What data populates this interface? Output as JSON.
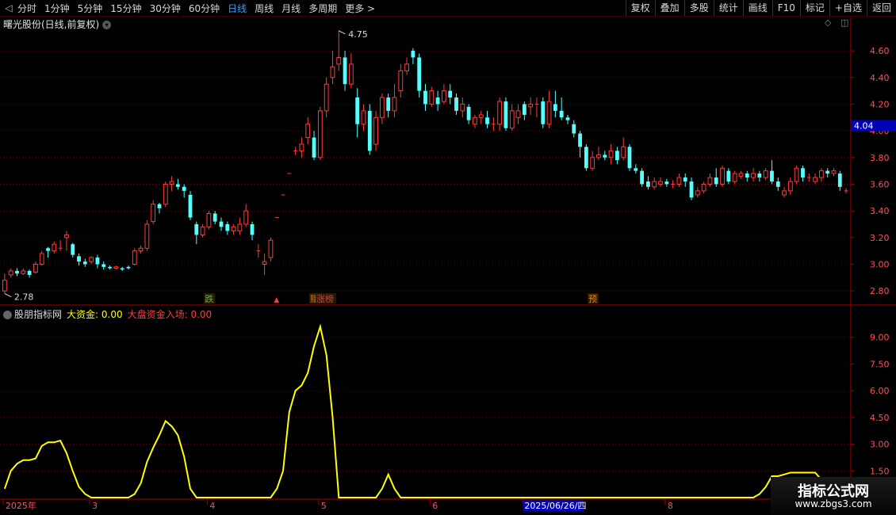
{
  "toolbar": {
    "tabs": [
      "分时",
      "1分钟",
      "5分钟",
      "15分钟",
      "30分钟",
      "60分钟",
      "日线",
      "周线",
      "月线",
      "多周期",
      "更多 >"
    ],
    "active_tab": "日线",
    "right_buttons": [
      "复权",
      "叠加",
      "多股",
      "统计",
      "画线",
      "F10",
      "标记",
      "+自选",
      "返回"
    ]
  },
  "stock": {
    "title": "曙光股份(日线,前复权)",
    "current_price_label": "4.04",
    "high_label": "4.75",
    "low_label": "2.78"
  },
  "indicator": {
    "name": "股朋指标网",
    "big_fund": "大资金: 0.00",
    "market_fund": "大盘资金入场: 0.00"
  },
  "signals": [
    {
      "day": 33,
      "text": "跌",
      "color": "#3cc43c"
    },
    {
      "day": 44,
      "text": "▲",
      "color": "#ff3b3b"
    },
    {
      "day": 50,
      "text": "赚",
      "color": "#c87a2a"
    },
    {
      "day": 51,
      "text": "涨榜",
      "color": "#d04040"
    },
    {
      "day": 95,
      "text": "预",
      "color": "#e08a2a"
    }
  ],
  "date_axis": {
    "labels": [
      {
        "day": 0,
        "text": "2025年"
      },
      {
        "day": 14,
        "text": "3"
      },
      {
        "day": 33,
        "text": "4"
      },
      {
        "day": 51,
        "text": "5"
      },
      {
        "day": 69,
        "text": "6"
      },
      {
        "day": 84,
        "text": "2025/06/26/四",
        "highlight": true
      },
      {
        "day": 107,
        "text": "8"
      }
    ]
  },
  "watermark": {
    "line1": "指标公式网",
    "line2": "www.zbgs3.com"
  },
  "colors": {
    "up": "#ff3b3b",
    "down": "#54ffff",
    "indicator_line": "#ffff00",
    "grid": "#5a0000",
    "axis_text": "#ff5050",
    "price_tag_bg": "#0000b4"
  },
  "chart_data": [
    {
      "type": "candlestick",
      "title": "曙光股份(日线,前复权)",
      "ylim": [
        2.7,
        4.85
      ],
      "y_ticks": [
        2.8,
        3.0,
        3.2,
        3.4,
        3.6,
        3.8,
        4.0,
        4.2,
        4.4,
        4.6
      ],
      "candles": [
        [
          2.8,
          2.88,
          2.78,
          2.93
        ],
        [
          2.92,
          2.95,
          2.9,
          2.97
        ],
        [
          2.95,
          2.93,
          2.91,
          2.97
        ],
        [
          2.93,
          2.95,
          2.92,
          2.97
        ],
        [
          2.95,
          2.92,
          2.9,
          2.96
        ],
        [
          2.94,
          3.0,
          2.93,
          3.02
        ],
        [
          3.0,
          3.08,
          2.99,
          3.1
        ],
        [
          3.12,
          3.1,
          3.05,
          3.13
        ],
        [
          3.1,
          3.15,
          3.08,
          3.17
        ],
        [
          3.12,
          3.12,
          3.1,
          3.18
        ],
        [
          3.2,
          3.22,
          3.1,
          3.25
        ],
        [
          3.15,
          3.07,
          3.05,
          3.16
        ],
        [
          3.06,
          3.02,
          2.99,
          3.08
        ],
        [
          3.02,
          3.0,
          2.98,
          3.04
        ],
        [
          3.02,
          3.05,
          3.0,
          3.06
        ],
        [
          3.05,
          3.0,
          2.97,
          3.07
        ],
        [
          3.0,
          2.98,
          2.96,
          3.02
        ],
        [
          2.98,
          2.97,
          2.96,
          2.99
        ],
        [
          2.97,
          2.98,
          2.96,
          2.99
        ],
        [
          2.97,
          2.96,
          2.95,
          2.98
        ],
        [
          2.98,
          2.97,
          2.96,
          2.99
        ],
        [
          3.0,
          3.1,
          2.99,
          3.12
        ],
        [
          3.1,
          3.12,
          3.08,
          3.14
        ],
        [
          3.12,
          3.3,
          3.1,
          3.33
        ],
        [
          3.32,
          3.45,
          3.3,
          3.48
        ],
        [
          3.45,
          3.42,
          3.38,
          3.46
        ],
        [
          3.45,
          3.6,
          3.43,
          3.62
        ],
        [
          3.6,
          3.62,
          3.55,
          3.66
        ],
        [
          3.6,
          3.58,
          3.56,
          3.64
        ],
        [
          3.58,
          3.55,
          3.5,
          3.6
        ],
        [
          3.52,
          3.35,
          3.33,
          3.55
        ],
        [
          3.3,
          3.22,
          3.15,
          3.32
        ],
        [
          3.22,
          3.28,
          3.2,
          3.3
        ],
        [
          3.28,
          3.38,
          3.26,
          3.4
        ],
        [
          3.38,
          3.32,
          3.3,
          3.4
        ],
        [
          3.32,
          3.28,
          3.25,
          3.35
        ],
        [
          3.3,
          3.25,
          3.22,
          3.32
        ],
        [
          3.25,
          3.28,
          3.22,
          3.3
        ],
        [
          3.25,
          3.3,
          3.22,
          3.35
        ],
        [
          3.3,
          3.4,
          3.28,
          3.45
        ],
        [
          3.3,
          3.22,
          3.18,
          3.32
        ],
        [
          3.1,
          3.1,
          3.05,
          3.15
        ],
        [
          3.0,
          3.02,
          2.92,
          3.08
        ],
        [
          3.05,
          3.18,
          3.02,
          3.2
        ],
        [
          3.35,
          3.35,
          3.35,
          3.35
        ],
        [
          3.52,
          3.52,
          3.52,
          3.52
        ],
        [
          3.68,
          3.68,
          3.68,
          3.68
        ],
        [
          3.85,
          3.85,
          3.82,
          3.88
        ],
        [
          3.85,
          3.9,
          3.8,
          3.95
        ],
        [
          3.95,
          4.05,
          3.9,
          4.1
        ],
        [
          3.95,
          3.8,
          3.78,
          4.0
        ],
        [
          3.8,
          4.15,
          3.78,
          4.18
        ],
        [
          4.15,
          4.35,
          4.1,
          4.4
        ],
        [
          4.4,
          4.48,
          4.35,
          4.6
        ],
        [
          4.5,
          4.55,
          4.45,
          4.75
        ],
        [
          4.55,
          4.35,
          4.3,
          4.6
        ],
        [
          4.35,
          4.5,
          4.32,
          4.58
        ],
        [
          4.25,
          4.05,
          3.95,
          4.32
        ],
        [
          4.05,
          4.15,
          4.0,
          4.2
        ],
        [
          4.15,
          3.85,
          3.82,
          4.2
        ],
        [
          3.9,
          4.1,
          3.85,
          4.15
        ],
        [
          4.1,
          4.25,
          4.05,
          4.28
        ],
        [
          4.25,
          4.15,
          4.1,
          4.28
        ],
        [
          4.15,
          4.25,
          4.1,
          4.35
        ],
        [
          4.3,
          4.45,
          4.25,
          4.5
        ],
        [
          4.45,
          4.5,
          4.42,
          4.55
        ],
        [
          4.6,
          4.55,
          4.5,
          4.62
        ],
        [
          4.55,
          4.3,
          4.25,
          4.58
        ],
        [
          4.3,
          4.2,
          4.15,
          4.35
        ],
        [
          4.2,
          4.3,
          4.18,
          4.33
        ],
        [
          4.25,
          4.2,
          4.15,
          4.3
        ],
        [
          4.22,
          4.3,
          4.2,
          4.35
        ],
        [
          4.3,
          4.25,
          4.2,
          4.35
        ],
        [
          4.25,
          4.15,
          4.12,
          4.28
        ],
        [
          4.15,
          4.2,
          4.1,
          4.25
        ],
        [
          4.18,
          4.08,
          4.05,
          4.2
        ],
        [
          4.05,
          4.1,
          4.02,
          4.12
        ],
        [
          4.1,
          4.12,
          4.05,
          4.15
        ],
        [
          4.1,
          4.05,
          4.02,
          4.15
        ],
        [
          4.05,
          4.05,
          4.0,
          4.1
        ],
        [
          4.05,
          4.22,
          4.0,
          4.25
        ],
        [
          4.22,
          4.02,
          4.0,
          4.25
        ],
        [
          4.02,
          4.15,
          4.0,
          4.2
        ],
        [
          4.1,
          4.15,
          4.05,
          4.2
        ],
        [
          4.2,
          4.12,
          4.08,
          4.22
        ],
        [
          4.18,
          4.2,
          4.12,
          4.25
        ],
        [
          4.2,
          4.2,
          4.1,
          4.25
        ],
        [
          4.22,
          4.05,
          4.02,
          4.25
        ],
        [
          4.05,
          4.22,
          4.02,
          4.3
        ],
        [
          4.2,
          4.15,
          4.1,
          4.3
        ],
        [
          4.15,
          4.1,
          4.08,
          4.25
        ],
        [
          4.1,
          4.08,
          4.05,
          4.12
        ],
        [
          4.05,
          3.98,
          3.95,
          4.08
        ],
        [
          3.98,
          3.88,
          3.8,
          4.0
        ],
        [
          3.88,
          3.72,
          3.7,
          3.9
        ],
        [
          3.72,
          3.8,
          3.7,
          3.85
        ],
        [
          3.8,
          3.82,
          3.78,
          3.88
        ],
        [
          3.82,
          3.8,
          3.78,
          3.85
        ],
        [
          3.8,
          3.85,
          3.75,
          3.9
        ],
        [
          3.85,
          3.78,
          3.75,
          3.88
        ],
        [
          3.8,
          3.88,
          3.78,
          3.95
        ],
        [
          3.88,
          3.72,
          3.7,
          3.9
        ],
        [
          3.72,
          3.7,
          3.68,
          3.75
        ],
        [
          3.7,
          3.6,
          3.58,
          3.72
        ],
        [
          3.62,
          3.58,
          3.56,
          3.66
        ],
        [
          3.58,
          3.62,
          3.56,
          3.65
        ],
        [
          3.6,
          3.62,
          3.58,
          3.65
        ],
        [
          3.62,
          3.6,
          3.58,
          3.64
        ],
        [
          3.6,
          3.6,
          3.57,
          3.63
        ],
        [
          3.6,
          3.65,
          3.58,
          3.68
        ],
        [
          3.65,
          3.62,
          3.58,
          3.68
        ],
        [
          3.62,
          3.5,
          3.48,
          3.65
        ],
        [
          3.52,
          3.55,
          3.5,
          3.58
        ],
        [
          3.55,
          3.6,
          3.53,
          3.62
        ],
        [
          3.6,
          3.65,
          3.58,
          3.68
        ],
        [
          3.65,
          3.6,
          3.58,
          3.72
        ],
        [
          3.6,
          3.72,
          3.58,
          3.74
        ],
        [
          3.7,
          3.62,
          3.6,
          3.72
        ],
        [
          3.62,
          3.68,
          3.6,
          3.7
        ],
        [
          3.66,
          3.68,
          3.64,
          3.7
        ],
        [
          3.68,
          3.65,
          3.62,
          3.7
        ],
        [
          3.65,
          3.68,
          3.62,
          3.72
        ],
        [
          3.68,
          3.65,
          3.62,
          3.7
        ],
        [
          3.65,
          3.7,
          3.63,
          3.72
        ],
        [
          3.7,
          3.62,
          3.6,
          3.78
        ],
        [
          3.62,
          3.58,
          3.55,
          3.65
        ],
        [
          3.52,
          3.55,
          3.5,
          3.58
        ],
        [
          3.55,
          3.62,
          3.52,
          3.65
        ],
        [
          3.62,
          3.72,
          3.6,
          3.74
        ],
        [
          3.72,
          3.65,
          3.62,
          3.74
        ],
        [
          3.65,
          3.65,
          3.62,
          3.68
        ],
        [
          3.62,
          3.65,
          3.6,
          3.68
        ],
        [
          3.65,
          3.7,
          3.62,
          3.72
        ],
        [
          3.7,
          3.68,
          3.65,
          3.72
        ],
        [
          3.68,
          3.7,
          3.66,
          3.72
        ],
        [
          3.68,
          3.58,
          3.55,
          3.7
        ],
        [
          3.55,
          3.55,
          3.53,
          3.57
        ]
      ]
    },
    {
      "type": "line",
      "title": "股朋指标网",
      "ylim": [
        0,
        10.5
      ],
      "y_ticks": [
        1.5,
        3.0,
        4.5,
        6.0,
        7.5,
        9.0
      ],
      "series": [
        {
          "name": "大资金",
          "values": [
            0.5,
            1.5,
            1.9,
            2.1,
            2.1,
            2.2,
            2.9,
            3.1,
            3.1,
            3.2,
            2.5,
            1.5,
            0.6,
            0.2,
            0.0,
            0.0,
            0.0,
            0.0,
            0.0,
            0.0,
            0.0,
            0.2,
            0.8,
            2.0,
            2.8,
            3.5,
            4.3,
            4.0,
            3.5,
            2.3,
            0.5,
            0.0,
            0.0,
            0.0,
            0.0,
            0.0,
            0.0,
            0.0,
            0.0,
            0.0,
            0.0,
            0.0,
            0.0,
            0.0,
            0.5,
            1.5,
            4.8,
            6.0,
            6.3,
            7.0,
            8.5,
            9.6,
            8.0,
            4.5,
            0.0,
            0.0,
            0.0,
            0.0,
            0.0,
            0.0,
            0.0,
            0.5,
            1.3,
            0.5,
            0.0,
            0.0,
            0.0,
            0.0,
            0.0,
            0.0,
            0.0,
            0.0,
            0.0,
            0.0,
            0.0,
            0.0,
            0.0,
            0.0,
            0.0,
            0.0,
            0.0,
            0.0,
            0.0,
            0.0,
            0.0,
            0.0,
            0.0,
            0.0,
            0.0,
            0.0,
            0.0,
            0.0,
            0.0,
            0.0,
            0.0,
            0.0,
            0.0,
            0.0,
            0.0,
            0.0,
            0.0,
            0.0,
            0.0,
            0.0,
            0.0,
            0.0,
            0.0,
            0.0,
            0.0,
            0.0,
            0.0,
            0.0,
            0.0,
            0.0,
            0.0,
            0.0,
            0.0,
            0.0,
            0.0,
            0.0,
            0.0,
            0.0,
            0.2,
            0.6,
            1.2,
            1.2,
            1.3,
            1.4,
            1.4,
            1.4,
            1.4,
            1.4,
            1.0,
            0.2,
            0.0,
            0.0,
            0.0,
            0.0,
            0.0
          ]
        }
      ]
    }
  ]
}
